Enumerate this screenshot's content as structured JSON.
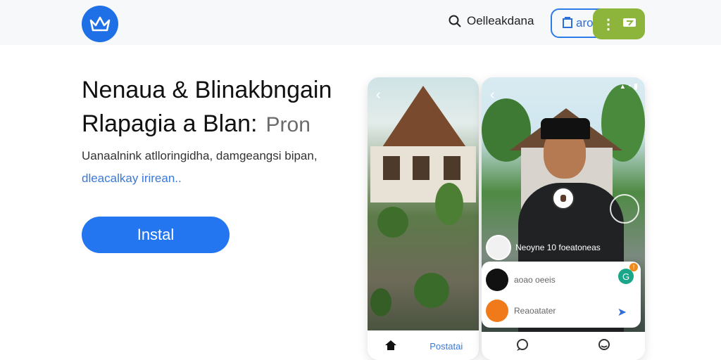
{
  "header": {
    "search_label": "Oelleakdana",
    "outline_button_label": "aro",
    "green_button_label": "⋮"
  },
  "hero": {
    "title_line1": "Nenaua & Blinakbngain",
    "title_line2": "Rlapagia a Blan:",
    "title_suffix": "Pron",
    "description_line1": "Uanaalnink atlloringidha, damgeangsi bipan,",
    "description_line2": "dleacalkay irirean..",
    "install_label": "Instal"
  },
  "phone_left": {
    "nav_link_label": "Postatai"
  },
  "phone_right": {
    "caption": "Neoyne 10 foeatoneas",
    "card_row1_text": "aoao oeeis",
    "card_row2_text": "Reaoatater",
    "badge_text": "G",
    "notification_text": "!"
  },
  "colors": {
    "brand_blue": "#2376f0",
    "green_button": "#8db53b"
  }
}
